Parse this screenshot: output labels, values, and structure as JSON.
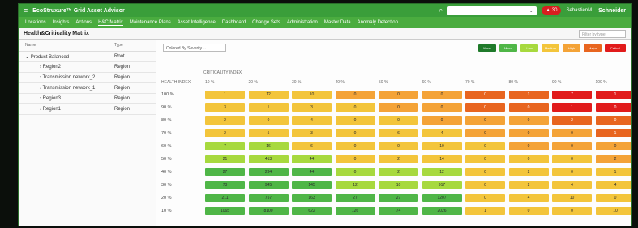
{
  "app": {
    "title": "EcoStruxure™ Grid Asset Advisor",
    "alert_count": "30",
    "user": "SebastienM",
    "brand": "Schneider"
  },
  "nav": [
    "Locations",
    "Insights",
    "Actions",
    "H&C Matrix",
    "Maintenance Plans",
    "Asset Intelligence",
    "Dashboard",
    "Change Sets",
    "Administration",
    "Master Data",
    "Anomaly Detection"
  ],
  "page": {
    "title": "Health&Criticality Matrix",
    "filter_placeholder": "Filter by type"
  },
  "tree": {
    "headers": {
      "name": "Name",
      "type": "Type"
    },
    "rows": [
      {
        "name": "Product Balanced",
        "type": "Root"
      },
      {
        "name": "Region2",
        "type": "Region"
      },
      {
        "name": "Transmission network_2",
        "type": "Region"
      },
      {
        "name": "Transmission network_1",
        "type": "Region"
      },
      {
        "name": "Region3",
        "type": "Region"
      },
      {
        "name": "Region1",
        "type": "Region"
      }
    ]
  },
  "matrix": {
    "color_by": "Colored By Severity",
    "legend": [
      {
        "label": "None",
        "color": "#1f7a2a"
      },
      {
        "label": "Minor",
        "color": "#4fb647"
      },
      {
        "label": "Low",
        "color": "#a7d93e"
      },
      {
        "label": "Medium",
        "color": "#f3c53b"
      },
      {
        "label": "High",
        "color": "#f4a337"
      },
      {
        "label": "Major",
        "color": "#e8651f"
      },
      {
        "label": "Critical",
        "color": "#e11b1b"
      }
    ],
    "criticality_label": "CRITICALITY INDEX",
    "health_label": "HEALTH INDEX",
    "columns": [
      "10 %",
      "20 %",
      "30 %",
      "40 %",
      "50 %",
      "60 %",
      "70 %",
      "80 %",
      "90 %",
      "100 %"
    ],
    "rows": [
      {
        "label": "100 %",
        "values": [
          "1",
          "12",
          "10",
          "0",
          "0",
          "0",
          "0",
          "1",
          "7",
          "1"
        ],
        "colors": [
          "#f3c53b",
          "#f3c53b",
          "#f3c53b",
          "#f4a337",
          "#f4a337",
          "#f4a337",
          "#e8651f",
          "#e8651f",
          "#e11b1b",
          "#e11b1b"
        ]
      },
      {
        "label": "90 %",
        "values": [
          "3",
          "1",
          "3",
          "0",
          "0",
          "0",
          "0",
          "0",
          "1",
          "0"
        ],
        "colors": [
          "#f3c53b",
          "#f3c53b",
          "#f3c53b",
          "#f3c53b",
          "#f4a337",
          "#f4a337",
          "#e8651f",
          "#e8651f",
          "#e11b1b",
          "#e11b1b"
        ]
      },
      {
        "label": "80 %",
        "values": [
          "2",
          "0",
          "4",
          "0",
          "0",
          "0",
          "0",
          "0",
          "2",
          "0"
        ],
        "colors": [
          "#f3c53b",
          "#f3c53b",
          "#f3c53b",
          "#f3c53b",
          "#f3c53b",
          "#f4a337",
          "#f4a337",
          "#f4a337",
          "#e8651f",
          "#e8651f"
        ]
      },
      {
        "label": "70 %",
        "values": [
          "2",
          "5",
          "3",
          "0",
          "6",
          "4",
          "0",
          "0",
          "0",
          "1"
        ],
        "colors": [
          "#f3c53b",
          "#f3c53b",
          "#f3c53b",
          "#f3c53b",
          "#f3c53b",
          "#f3c53b",
          "#f4a337",
          "#f4a337",
          "#f4a337",
          "#e8651f"
        ]
      },
      {
        "label": "60 %",
        "values": [
          "7",
          "16",
          "6",
          "0",
          "0",
          "10",
          "0",
          "0",
          "0",
          "0"
        ],
        "colors": [
          "#a7d93e",
          "#a7d93e",
          "#f3c53b",
          "#f3c53b",
          "#f3c53b",
          "#f3c53b",
          "#f3c53b",
          "#f4a337",
          "#f4a337",
          "#f4a337"
        ]
      },
      {
        "label": "50 %",
        "values": [
          "21",
          "413",
          "44",
          "0",
          "2",
          "14",
          "0",
          "0",
          "0",
          "2"
        ],
        "colors": [
          "#a7d93e",
          "#a7d93e",
          "#a7d93e",
          "#f3c53b",
          "#f3c53b",
          "#f3c53b",
          "#f3c53b",
          "#f3c53b",
          "#f3c53b",
          "#f4a337"
        ]
      },
      {
        "label": "40 %",
        "values": [
          "27",
          "234",
          "44",
          "0",
          "2",
          "12",
          "0",
          "2",
          "0",
          "1"
        ],
        "colors": [
          "#4fb647",
          "#4fb647",
          "#4fb647",
          "#a7d93e",
          "#a7d93e",
          "#a7d93e",
          "#f3c53b",
          "#f3c53b",
          "#f3c53b",
          "#f3c53b"
        ]
      },
      {
        "label": "30 %",
        "values": [
          "73",
          "945",
          "145",
          "12",
          "10",
          "917",
          "0",
          "2",
          "4",
          "4"
        ],
        "colors": [
          "#4fb647",
          "#4fb647",
          "#4fb647",
          "#a7d93e",
          "#a7d93e",
          "#a7d93e",
          "#f3c53b",
          "#f3c53b",
          "#f3c53b",
          "#f3c53b"
        ]
      },
      {
        "label": "20 %",
        "values": [
          "211",
          "757",
          "163",
          "27",
          "27",
          "1207",
          "0",
          "4",
          "10",
          "0"
        ],
        "colors": [
          "#4fb647",
          "#4fb647",
          "#4fb647",
          "#4fb647",
          "#4fb647",
          "#4fb647",
          "#f3c53b",
          "#f3c53b",
          "#f3c53b",
          "#f3c53b"
        ]
      },
      {
        "label": "10 %",
        "values": [
          "1065",
          "8100",
          "622",
          "126",
          "74",
          "2026",
          "1",
          "0",
          "0",
          "10"
        ],
        "colors": [
          "#4fb647",
          "#4fb647",
          "#4fb647",
          "#4fb647",
          "#4fb647",
          "#4fb647",
          "#f3c53b",
          "#f3c53b",
          "#f3c53b",
          "#f3c53b"
        ]
      }
    ]
  }
}
